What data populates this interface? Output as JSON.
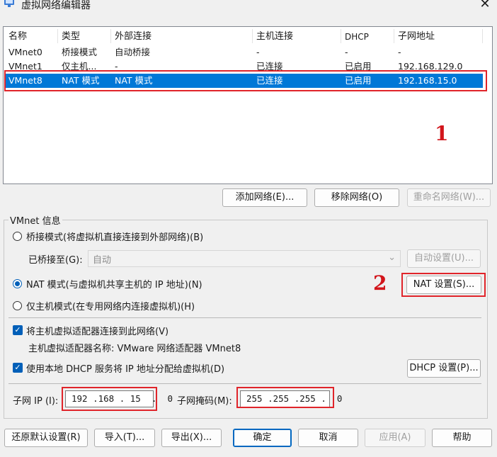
{
  "window": {
    "title": "虚拟网络编辑器",
    "close_glyph": "✕",
    "icon": "network-editor-icon"
  },
  "network_list": {
    "columns": [
      "名称",
      "类型",
      "外部连接",
      "主机连接",
      "DHCP",
      "子网地址"
    ],
    "rows": [
      {
        "name": "VMnet0",
        "type": "桥接模式",
        "external": "自动桥接",
        "host": "-",
        "dhcp": "-",
        "subnet": "-",
        "selected": false
      },
      {
        "name": "VMnet1",
        "type": "仅主机...",
        "external": "-",
        "host": "已连接",
        "dhcp": "已启用",
        "subnet": "192.168.129.0",
        "selected": false
      },
      {
        "name": "VMnet8",
        "type": "NAT 模式",
        "external": "NAT 模式",
        "host": "已连接",
        "dhcp": "已启用",
        "subnet": "192.168.15.0",
        "selected": true
      }
    ]
  },
  "annotations": {
    "one": "1",
    "two": "2",
    "color": "#d2151b"
  },
  "list_buttons": {
    "add": "添加网络(E)...",
    "remove": "移除网络(O)",
    "rename": "重命名网络(W)..."
  },
  "vmnet_info": {
    "group_label": "VMnet 信息",
    "bridge_mode": "桥接模式(将虚拟机直接连接到外部网络)(B)",
    "bridged_to_label": "已桥接至(G):",
    "bridged_to_value": "自动",
    "auto_settings": "自动设置(U)...",
    "nat_mode": "NAT 模式(与虚拟机共享主机的 IP 地址)(N)",
    "nat_settings": "NAT 设置(S)...",
    "host_only_mode": "仅主机模式(在专用网络内连接虚拟机)(H)",
    "selected_mode": "nat",
    "connect_adapter": "将主机虚拟适配器连接到此网络(V)",
    "connect_adapter_checked": true,
    "adapter_name": "主机虚拟适配器名称: VMware 网络适配器 VMnet8",
    "use_dhcp": "使用本地 DHCP 服务将 IP 地址分配给虚拟机(D)",
    "use_dhcp_checked": true,
    "dhcp_settings": "DHCP 设置(P)...",
    "subnet_ip_label": "子网 IP (I):",
    "subnet_ip_value": "192 .168 . 15  .  0",
    "subnet_mask_label": "子网掩码(M):",
    "subnet_mask_value": "255 .255 .255 .  0"
  },
  "footer_buttons": {
    "restore": "还原默认设置(R)",
    "import": "导入(T)...",
    "export": "导出(X)...",
    "ok": "确定",
    "cancel": "取消",
    "apply": "应用(A)",
    "help": "帮助"
  },
  "colors": {
    "selection": "#0078d7",
    "highlight_box": "#e0242a",
    "accent": "#005fb8"
  }
}
